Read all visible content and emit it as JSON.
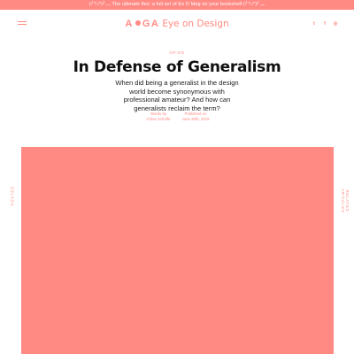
{
  "banner": {
    "text": "(╯°□°)╯︵ The ultimate flex: a full set of Eo D Mag on your bookshelf (╯°□°)╯︵"
  },
  "header": {
    "logo_aiga": "A",
    "logo_aiga_rest": "GA",
    "logo_eod": "Eye on Design",
    "social": [
      "twitter-icon",
      "facebook-icon",
      "instagram-icon"
    ]
  },
  "article": {
    "category": "OP-ED",
    "title": "In Defense of Generalism",
    "subtitle": "When did being a generalist in the design world become synonymous with professional amateur? And how can generalists reclaim the term?",
    "words_by_label": "Words by",
    "author": "Chloe Scheffe",
    "published_label": "Published on",
    "published_date": "June 20th, 2019"
  },
  "side": {
    "left": "POSTED",
    "right": "RELATED ARTICLES"
  },
  "colors": {
    "accent": "#ff8a84",
    "text": "#111111",
    "background": "#ffffff"
  }
}
